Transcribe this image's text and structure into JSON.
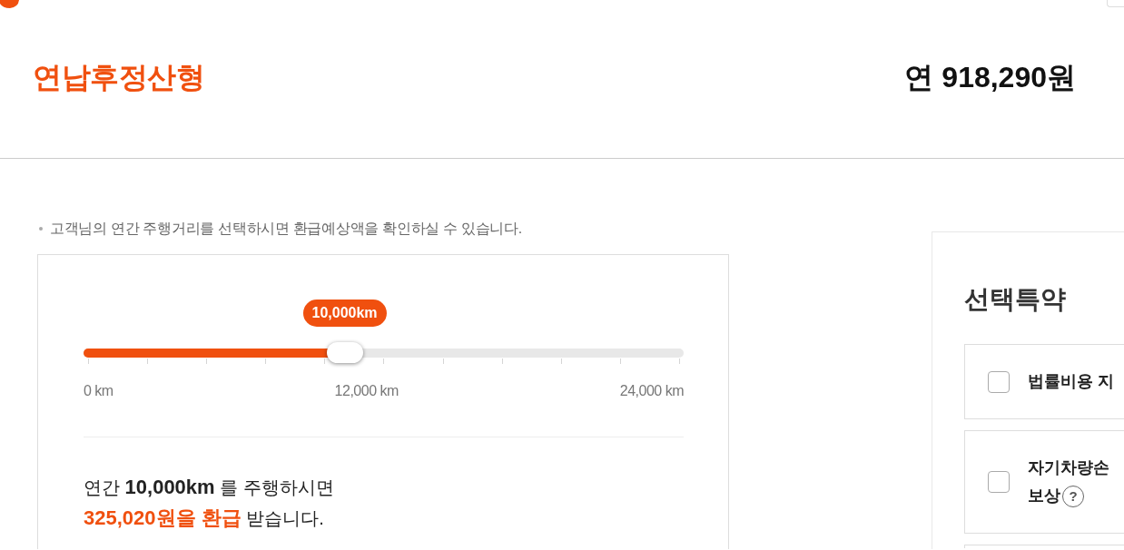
{
  "header": {
    "title": "연납후정산형",
    "price": "연 918,290원"
  },
  "notice": "고객님의 연간 주행거리를 선택하시면 환급예상액을 확인하실 수 있습니다.",
  "slider": {
    "value_label": "10,000km",
    "level": 0.435,
    "scale_labels": [
      "0 km",
      "12,000 km",
      "24,000 km"
    ]
  },
  "result": {
    "lines": [
      "연간 **10,000km** 를 주행하시면",
      "**325,020원을 환급** 받습니다."
    ]
  },
  "options_panel": {
    "title": "선택특약",
    "options": [
      {
        "lines": [
          "법률비용 지"
        ],
        "checked": false
      },
      {
        "lines": [
          "자기차량손",
          "보상"
        ],
        "checked": false,
        "help": "?"
      }
    ]
  }
}
